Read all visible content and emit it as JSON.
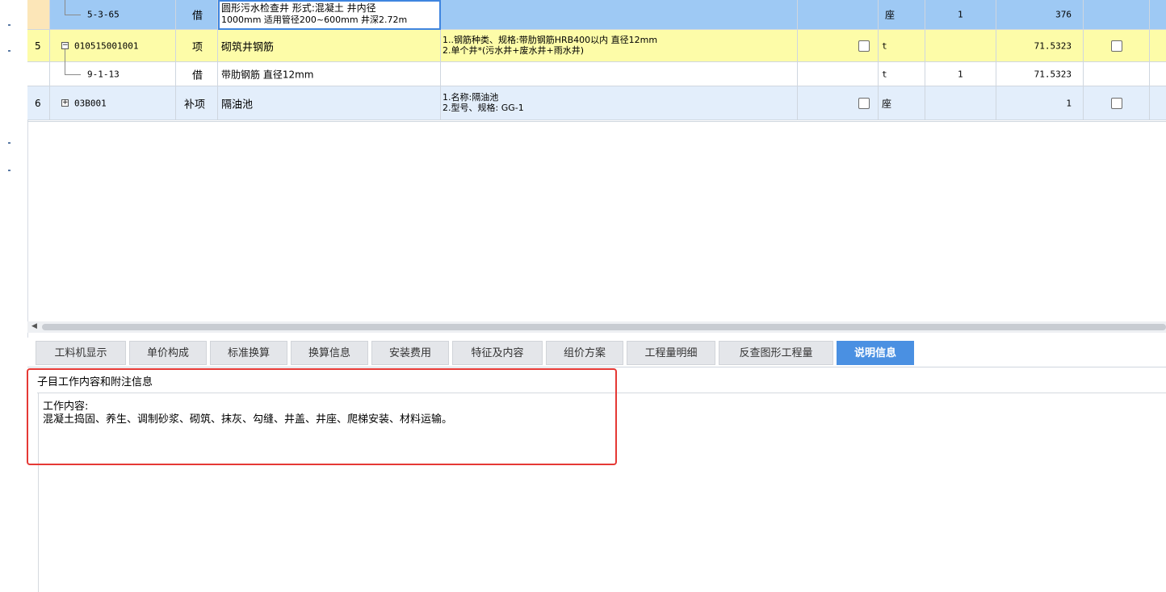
{
  "rows": [
    {
      "no": "",
      "code": "5-3-65",
      "type": "借",
      "name_line1": "圆形污水检查井 形式:混凝土 井内径",
      "name_line2": "1000mm 适用管径200~600mm 井深2.72m",
      "features": [],
      "unit": "座",
      "qty": "1",
      "value": "376"
    },
    {
      "no": "5",
      "code": "010515001001",
      "type": "项",
      "name": "砌筑井钢筋",
      "features": [
        "1..钢筋种类、规格:带肋钢筋HRB400以内 直径12mm",
        "2.单个井*(污水井+废水井+雨水井)"
      ],
      "unit": "t",
      "qty": "",
      "value": "71.5323"
    },
    {
      "no": "",
      "code": "9-1-13",
      "type": "借",
      "name": "带肋钢筋 直径12mm",
      "features": [],
      "unit": "t",
      "qty": "1",
      "value": "71.5323"
    },
    {
      "no": "6",
      "code": "03B001",
      "type": "补项",
      "name": "隔油池",
      "features": [
        "1.名称:隔油池",
        "2.型号、规格: GG-1"
      ],
      "unit": "座",
      "qty": "",
      "value": "1"
    }
  ],
  "tabs": [
    "工料机显示",
    "单价构成",
    "标准换算",
    "换算信息",
    "安装费用",
    "特征及内容",
    "组价方案",
    "工程量明细",
    "反查图形工程量",
    "说明信息"
  ],
  "active_tab": "说明信息",
  "panel": {
    "title": "子目工作内容和附注信息",
    "content_label": "工作内容:",
    "content_text": "混凝土捣固、养生、调制砂浆、砌筑、抹灰、勾缝、井盖、井座、爬梯安装、材料运输。"
  },
  "colors": {
    "selected_row": "#9ec9f4",
    "parent_row": "#fdfca8",
    "supplement_row": "#e3eefb",
    "active_tab": "#4a90e2",
    "highlight_border": "#e53935"
  }
}
